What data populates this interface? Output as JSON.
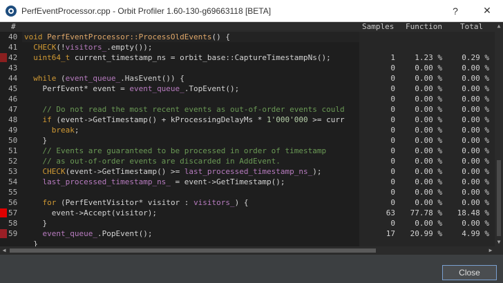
{
  "window": {
    "title": "PerfEventProcessor.cpp - Orbit Profiler 1.60-130-g69663118 [BETA]",
    "help_glyph": "?",
    "close_glyph": "✕"
  },
  "table": {
    "headers": {
      "line": "#",
      "samples": "Samples",
      "function": "Function",
      "total": "Total"
    },
    "rows": [
      {
        "ln": "40",
        "heat": "",
        "code": [
          [
            "kw",
            "void "
          ],
          [
            "fn",
            "PerfEventProcessor::ProcessOldEvents"
          ],
          [
            "pl",
            "() {"
          ]
        ],
        "samples": "",
        "func": "",
        "total": ""
      },
      {
        "ln": "41",
        "heat": "",
        "code": [
          [
            "pl",
            "  "
          ],
          [
            "kw",
            "CHECK"
          ],
          [
            "pl",
            "(!"
          ],
          [
            "id",
            "visitors_"
          ],
          [
            "pl",
            ".empty());"
          ]
        ],
        "samples": "",
        "func": "",
        "total": ""
      },
      {
        "ln": "42",
        "heat": "#8a1f1f",
        "code": [
          [
            "pl",
            "  "
          ],
          [
            "kw",
            "uint64_t"
          ],
          [
            "pl",
            " current_timestamp_ns = orbit_base::CaptureTimestampNs();"
          ]
        ],
        "samples": "1",
        "func": "1.23 %",
        "total": "0.29 %"
      },
      {
        "ln": "43",
        "heat": "",
        "code": [],
        "samples": "0",
        "func": "0.00 %",
        "total": "0.00 %"
      },
      {
        "ln": "44",
        "heat": "",
        "code": [
          [
            "pl",
            "  "
          ],
          [
            "kw",
            "while"
          ],
          [
            "pl",
            " ("
          ],
          [
            "id",
            "event_queue_"
          ],
          [
            "pl",
            ".HasEvent()) {"
          ]
        ],
        "samples": "0",
        "func": "0.00 %",
        "total": "0.00 %"
      },
      {
        "ln": "45",
        "heat": "",
        "code": [
          [
            "pl",
            "    PerfEvent* event = "
          ],
          [
            "id",
            "event_queue_"
          ],
          [
            "pl",
            ".TopEvent();"
          ]
        ],
        "samples": "0",
        "func": "0.00 %",
        "total": "0.00 %"
      },
      {
        "ln": "46",
        "heat": "",
        "code": [],
        "samples": "0",
        "func": "0.00 %",
        "total": "0.00 %"
      },
      {
        "ln": "47",
        "heat": "",
        "code": [
          [
            "cm",
            "    // Do not read the most recent events as out-of-order events could"
          ]
        ],
        "samples": "0",
        "func": "0.00 %",
        "total": "0.00 %"
      },
      {
        "ln": "48",
        "heat": "",
        "code": [
          [
            "pl",
            "    "
          ],
          [
            "kw",
            "if"
          ],
          [
            "pl",
            " (event->GetTimestamp() + kProcessingDelayMs * "
          ],
          [
            "nm",
            "1'000'000"
          ],
          [
            "pl",
            " >= curr"
          ]
        ],
        "samples": "0",
        "func": "0.00 %",
        "total": "0.00 %"
      },
      {
        "ln": "49",
        "heat": "",
        "code": [
          [
            "pl",
            "      "
          ],
          [
            "kw",
            "break"
          ],
          [
            "pl",
            ";"
          ]
        ],
        "samples": "0",
        "func": "0.00 %",
        "total": "0.00 %"
      },
      {
        "ln": "50",
        "heat": "",
        "code": [
          [
            "pl",
            "    }"
          ]
        ],
        "samples": "0",
        "func": "0.00 %",
        "total": "0.00 %"
      },
      {
        "ln": "51",
        "heat": "",
        "code": [
          [
            "cm",
            "    // Events are guaranteed to be processed in order of timestamp"
          ]
        ],
        "samples": "0",
        "func": "0.00 %",
        "total": "0.00 %"
      },
      {
        "ln": "52",
        "heat": "",
        "code": [
          [
            "cm",
            "    // as out-of-order events are discarded in AddEvent."
          ]
        ],
        "samples": "0",
        "func": "0.00 %",
        "total": "0.00 %"
      },
      {
        "ln": "53",
        "heat": "",
        "code": [
          [
            "pl",
            "    "
          ],
          [
            "kw",
            "CHECK"
          ],
          [
            "pl",
            "(event->GetTimestamp() >= "
          ],
          [
            "id",
            "last_processed_timestamp_ns_"
          ],
          [
            "pl",
            ");"
          ]
        ],
        "samples": "0",
        "func": "0.00 %",
        "total": "0.00 %"
      },
      {
        "ln": "54",
        "heat": "",
        "code": [
          [
            "pl",
            "    "
          ],
          [
            "id",
            "last_processed_timestamp_ns_"
          ],
          [
            "pl",
            " = event->GetTimestamp();"
          ]
        ],
        "samples": "0",
        "func": "0.00 %",
        "total": "0.00 %"
      },
      {
        "ln": "55",
        "heat": "",
        "code": [],
        "samples": "0",
        "func": "0.00 %",
        "total": "0.00 %"
      },
      {
        "ln": "56",
        "heat": "",
        "code": [
          [
            "pl",
            "    "
          ],
          [
            "kw",
            "for"
          ],
          [
            "pl",
            " (PerfEventVisitor* visitor : "
          ],
          [
            "id",
            "visitors_"
          ],
          [
            "pl",
            ") {"
          ]
        ],
        "samples": "0",
        "func": "0.00 %",
        "total": "0.00 %"
      },
      {
        "ln": "57",
        "heat": "#e00000",
        "code": [
          [
            "pl",
            "      event->Accept(visitor);"
          ]
        ],
        "samples": "63",
        "func": "77.78 %",
        "total": "18.48 %"
      },
      {
        "ln": "58",
        "heat": "",
        "code": [
          [
            "pl",
            "    }"
          ]
        ],
        "samples": "0",
        "func": "0.00 %",
        "total": "0.00 %"
      },
      {
        "ln": "59",
        "heat": "#9a1f26",
        "code": [
          [
            "pl",
            "    "
          ],
          [
            "id",
            "event_queue_"
          ],
          [
            "pl",
            ".PopEvent();"
          ]
        ],
        "samples": "17",
        "func": "20.99 %",
        "total": "4.99 %"
      },
      {
        "ln": "",
        "heat": "",
        "code": [
          [
            "pl",
            "  }"
          ]
        ],
        "samples": "",
        "func": "",
        "total": ""
      }
    ]
  },
  "footer": {
    "close_label": "Close"
  }
}
